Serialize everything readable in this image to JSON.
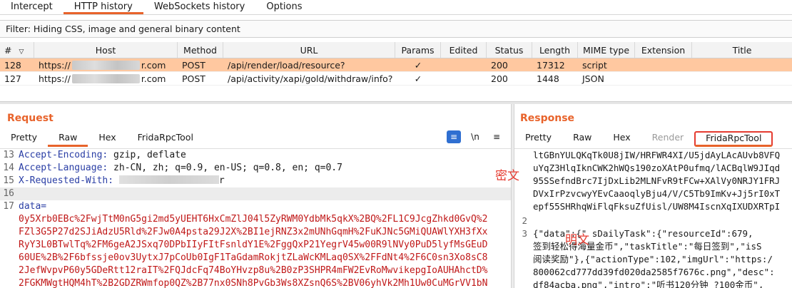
{
  "top_tabs": [
    {
      "label": "Intercept"
    },
    {
      "label": "HTTP history"
    },
    {
      "label": "WebSockets history"
    },
    {
      "label": "Options"
    }
  ],
  "filter_text": "Filter: Hiding CSS, image and general binary content",
  "table": {
    "headers": {
      "num": "#",
      "host": "Host",
      "method": "Method",
      "url": "URL",
      "params": "Params",
      "edited": "Edited",
      "status": "Status",
      "length": "Length",
      "mime": "MIME type",
      "extension": "Extension",
      "title": "Title"
    },
    "rows": [
      {
        "num": "128",
        "host_prefix": "https://",
        "host_suffix": "r.com",
        "method": "POST",
        "url": "/api/render/load/resource?",
        "params": "✓",
        "status": "200",
        "length": "17312",
        "mime": "script"
      },
      {
        "num": "127",
        "host_prefix": "https://",
        "host_suffix": "r.com",
        "method": "POST",
        "url": "/api/activity/xapi/gold/withdraw/info?",
        "params": "✓",
        "status": "200",
        "length": "1448",
        "mime": "JSON"
      }
    ]
  },
  "request": {
    "title": "Request",
    "tabs": [
      {
        "label": "Pretty"
      },
      {
        "label": "Raw"
      },
      {
        "label": "Hex"
      },
      {
        "label": "FridaRpcTool"
      }
    ],
    "tool_newline": "\\n",
    "tool_menu": "≡",
    "lines": [
      {
        "n": "13",
        "key": "Accept-Encoding:",
        "val": " gzip, deflate"
      },
      {
        "n": "14",
        "key": "Accept-Language:",
        "val": " zh-CN, zh; q=0.9, en-US; q=0.8, en; q=0.7"
      },
      {
        "n": "15",
        "key": "X-Requested-With:",
        "val": "r"
      },
      {
        "n": "16",
        "key": "",
        "val": ""
      },
      {
        "n": "17",
        "key": "data=",
        "val": ""
      }
    ],
    "data_lines": [
      "0y5Xrb0EBc%2FwjTtM0nG5gi2md5yUEHT6HxCmZlJ04l5ZyRWM0YdbMk5qkX%2BQ%2FL1C9JcgZhkd0GvQ%2",
      "FZl3G5P27d2SJiAdzU5Rld%2FJw0A4psta29J2X%2BI1ejRNZ3x2mUNhGqmH%2FuKJNc5GMiQUAWlYXH3fXx",
      "RyY3L0BTwlTq%2FM6geA2JSxq70DPbIIyFItFsnldY1E%2FggQxP21YegrV45w00R9lNVy0PuD5lyfMsGEuD",
      "60UE%2B%2F6bfssje0ov3UytxJ7pCoUb0IgF1TaGdamRokjtZLaWcKMLaq0SX%2FFdNt4%2F6C0sn3Xo8sC8",
      "2JefWvpvP60y5GDeRtt12raIT%2FQJdcFq74BoYHvzp8u%2B0zP3SHPR4mFW2EvRoMwvikepgIoAUHAhctD%",
      "2FGKMWgtHQM4hT%2B2GDZRWmfop0QZ%2B77nx0SNh8PvGb3Ws8XZsnQ6S%2BV06yhVk2Mh1Uw0CuMGrVV1bN"
    ]
  },
  "response": {
    "title": "Response",
    "tabs": [
      {
        "label": "Pretty"
      },
      {
        "label": "Raw"
      },
      {
        "label": "Hex"
      },
      {
        "label": "Render"
      },
      {
        "label": "FridaRpcTool"
      }
    ],
    "cipher_lines": [
      "ltGBnYULQKqTk0U8jIW/HRFWR4XI/U5jdAyLAcAUvb8VFQ",
      "uYqZ3HlqIknCWK2hWQs190zoXAtP0ufmq/lACBqlW9JIqd",
      "95SSefndBrc7IjDxLib2MLNFvR9tFCw+XAlVy0NRJY1FRJ",
      "DVxIrPzvcwyYEvCaaoqlyBju4/V/C5Tb9ImKv+Jj5rI0xT",
      "epf55SHRhqWiFlqFksuZfUisl/UW8M4IscnXqIXUDXRTpI"
    ],
    "plain_num": "2",
    "plain_num3": "3",
    "plain_lines": [
      "{\"data\":{\"  sDailyTask\":{\"resourceId\":679,",
      "签到轻松得海量金币\",\"taskTitle\":\"每日签到\",\"isS",
      "阅读奖励\"},{\"actionType\":102,\"imgUrl\":\"https:/",
      "800062cd777dd39fd020da2585f7676c.png\",\"desc\":",
      "df84acba.png\",\"intro\":\"听书120分钟  ?100金币\","
    ]
  },
  "annotations": {
    "cipher": "密文",
    "plain": "明文"
  },
  "colors": {
    "accent": "#e8632b",
    "selected_row": "#ffc8a0",
    "annotation": "#e53b30"
  }
}
